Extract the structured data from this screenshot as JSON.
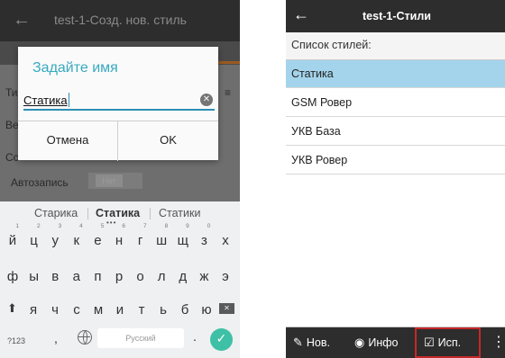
{
  "left_screen": {
    "title": "test-1-Созд. нов. стиль",
    "back_icon": "arrow-left-icon",
    "background_fragments": [
      "Ти",
      "Ве",
      "Сс"
    ],
    "background_fragment_right": "≡",
    "autosave_label": "Автозапись",
    "autosave_toggle": "Нет",
    "dialog": {
      "title": "Задайте имя",
      "input_value": "Статика",
      "clear_icon": "clear-circle-icon",
      "cancel_label": "Отмена",
      "ok_label": "OK"
    },
    "keyboard": {
      "suggestions": [
        "Старика",
        "Статика",
        "Статики"
      ],
      "row1": [
        {
          "ch": "й",
          "num": "1"
        },
        {
          "ch": "ц",
          "num": "2"
        },
        {
          "ch": "у",
          "num": "3"
        },
        {
          "ch": "к",
          "num": "4"
        },
        {
          "ch": "е",
          "num": "5"
        },
        {
          "ch": "н",
          "num": "6"
        },
        {
          "ch": "г",
          "num": "7"
        },
        {
          "ch": "ш",
          "num": "8"
        },
        {
          "ch": "щ",
          "num": "9"
        },
        {
          "ch": "з",
          "num": "0"
        },
        {
          "ch": "х",
          "num": ""
        }
      ],
      "row2": [
        "ф",
        "ы",
        "в",
        "а",
        "п",
        "р",
        "о",
        "л",
        "д",
        "ж",
        "э"
      ],
      "row3": [
        "я",
        "ч",
        "с",
        "м",
        "и",
        "т",
        "ь",
        "б",
        "ю"
      ],
      "symbols_key": "?123",
      "comma_key": ",",
      "space_label": "Русский",
      "period_key": ".",
      "shift_icon": "shift-icon",
      "backspace_icon": "backspace-icon",
      "globe_icon": "globe-icon",
      "enter_icon": "checkmark-icon"
    }
  },
  "right_screen": {
    "title": "test-1-Стили",
    "back_icon": "arrow-left-icon",
    "list_label": "Список стилей:",
    "items": [
      {
        "label": "Статика",
        "selected": true
      },
      {
        "label": "GSM Ровер",
        "selected": false
      },
      {
        "label": "УКВ База",
        "selected": false
      },
      {
        "label": "УКВ Ровер",
        "selected": false
      }
    ],
    "bottom_bar": [
      {
        "label": "Нов.",
        "icon": "new-style-icon"
      },
      {
        "label": "Инфо",
        "icon": "eye-icon"
      },
      {
        "label": "Исп.",
        "icon": "checkbox-check-icon",
        "highlighted": true
      }
    ],
    "more_icon": "more-vertical-icon"
  }
}
